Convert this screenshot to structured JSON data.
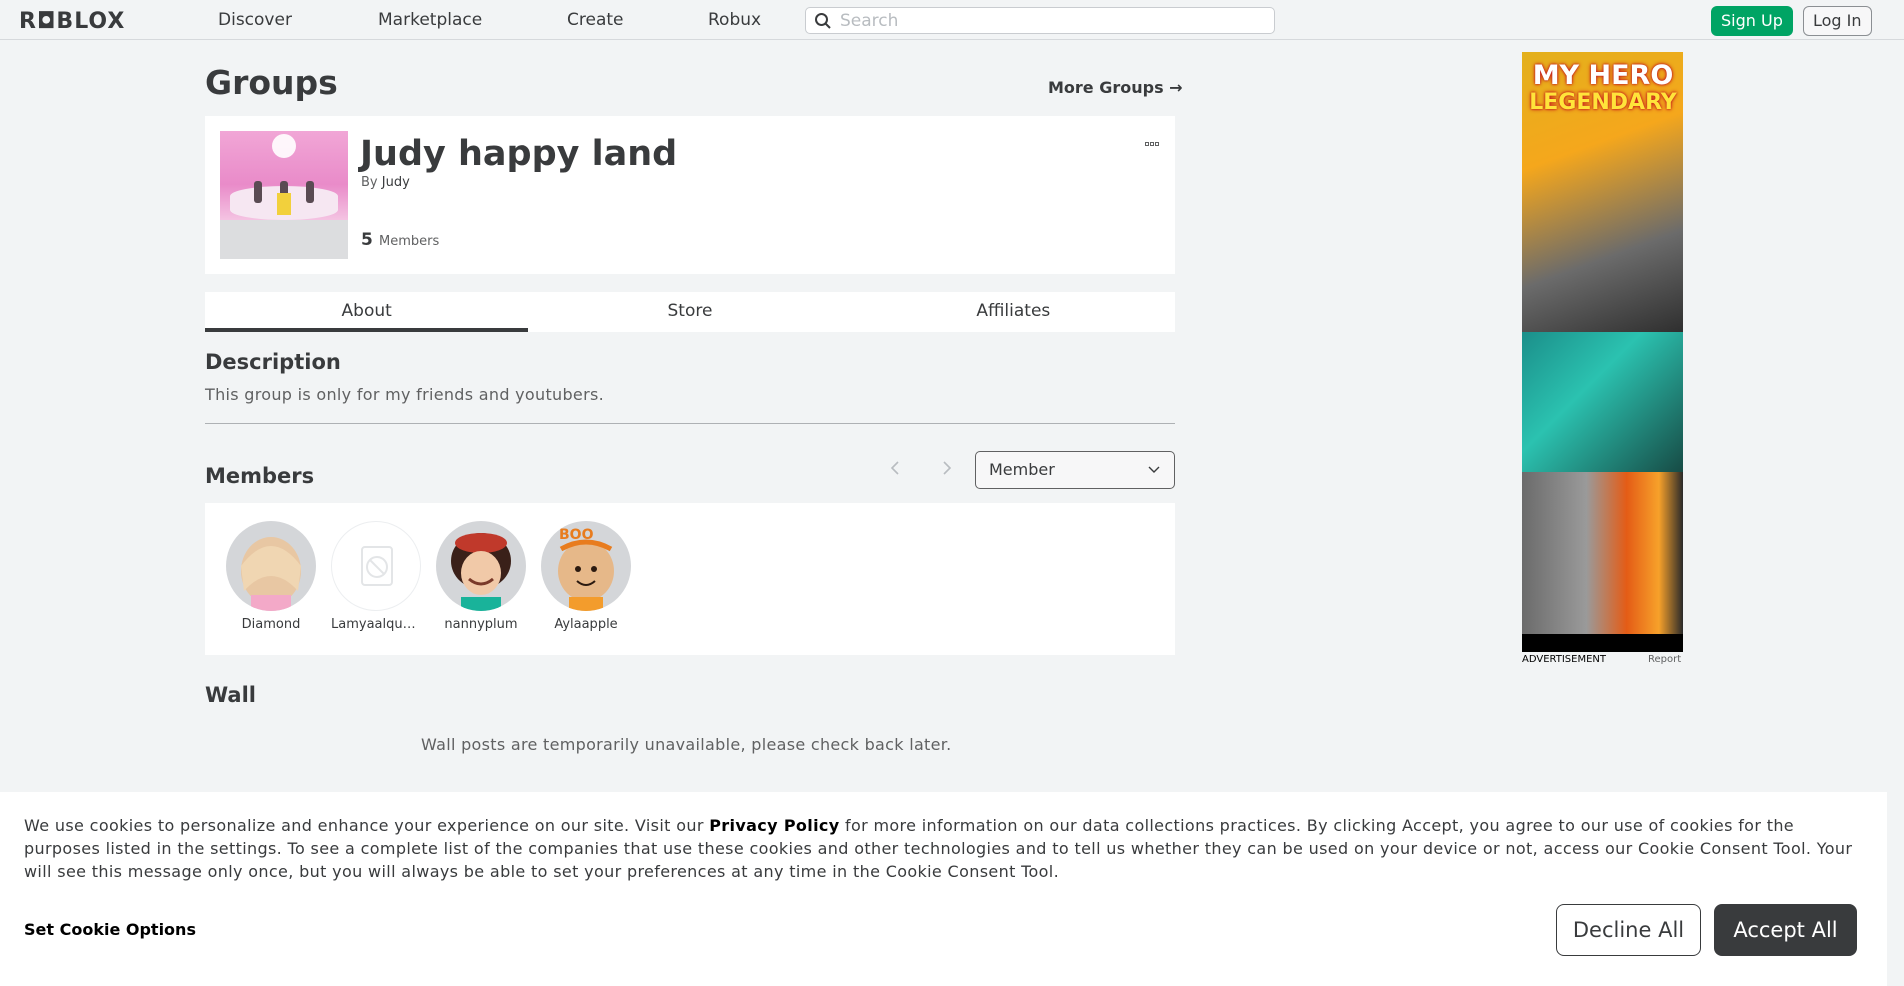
{
  "nav": {
    "logo": "R◘BLOX",
    "links": [
      "Discover",
      "Marketplace",
      "Create",
      "Robux"
    ],
    "search_placeholder": "Search",
    "signup": "Sign Up",
    "login": "Log In"
  },
  "page": {
    "title": "Groups",
    "more_groups": "More Groups →"
  },
  "group": {
    "name": "Judy happy land",
    "by_label": "By",
    "owner": "Judy",
    "member_count": "5",
    "members_label": "Members"
  },
  "tabs": [
    {
      "label": "About",
      "active": true
    },
    {
      "label": "Store",
      "active": false
    },
    {
      "label": "Affiliates",
      "active": false
    }
  ],
  "description": {
    "heading": "Description",
    "text": "This group is only for my friends and youtubers."
  },
  "members": {
    "heading": "Members",
    "role_selected": "Member",
    "list": [
      {
        "name": "Diamond",
        "avatar": "blonde-avatar"
      },
      {
        "name": "Lamyaalqub...",
        "avatar": "unavailable-image-icon"
      },
      {
        "name": "nannyplum",
        "avatar": "red-beret-avatar"
      },
      {
        "name": "Aylaapple",
        "avatar": "boo-headband-avatar"
      }
    ]
  },
  "wall": {
    "heading": "Wall",
    "message": "Wall posts are temporarily unavailable, please check back later."
  },
  "ad": {
    "title_line1": "MY HERO",
    "title_line2": "LEGENDARY",
    "label": "ADVERTISEMENT",
    "report": "Report"
  },
  "cookie": {
    "text_before": "We use cookies to personalize and enhance your experience on our site. Visit our ",
    "link": "Privacy Policy",
    "text_after": " for more information on our data collections practices. By clicking Accept, you agree to our use of cookies for the purposes listed in the settings. To see a complete list of the companies that use these cookies and other technologies and to tell us whether they can be used on your device or not, access our Cookie Consent Tool. Your will see this message only once, but you will always be able to set your preferences at any time in the Cookie Consent Tool.",
    "options": "Set Cookie Options",
    "decline": "Decline All",
    "accept": "Accept All"
  },
  "colors": {
    "accent_green": "#00a464",
    "text_dark": "#393b3d",
    "background": "#f2f4f5"
  }
}
